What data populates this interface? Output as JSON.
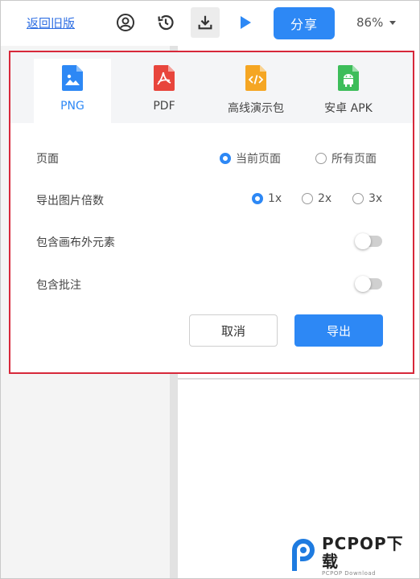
{
  "toolbar": {
    "back_label": "返回旧版",
    "share_label": "分享",
    "zoom_value": "86%",
    "icons": [
      "user-circle-icon",
      "history-icon",
      "download-icon",
      "play-icon"
    ]
  },
  "export_panel": {
    "formats": [
      {
        "label": "PNG",
        "icon": "png-file-icon",
        "color": "#2d88f5",
        "active": true
      },
      {
        "label": "PDF",
        "icon": "pdf-file-icon",
        "color": "#e8453c",
        "active": false
      },
      {
        "label": "高线演示包",
        "icon": "code-file-icon",
        "color": "#f5a623",
        "active": false
      },
      {
        "label": "安卓 APK",
        "icon": "android-file-icon",
        "color": "#3dbd5a",
        "active": false
      }
    ],
    "page_option": {
      "label": "页面",
      "options": [
        {
          "label": "当前页面",
          "checked": true
        },
        {
          "label": "所有页面",
          "checked": false
        }
      ]
    },
    "scale_option": {
      "label": "导出图片倍数",
      "options": [
        {
          "label": "1x",
          "checked": true
        },
        {
          "label": "2x",
          "checked": false
        },
        {
          "label": "3x",
          "checked": false
        }
      ]
    },
    "include_outside": {
      "label": "包含画布外元素",
      "enabled": false
    },
    "include_comments": {
      "label": "包含批注",
      "enabled": false
    },
    "cancel_label": "取消",
    "export_label": "导出"
  },
  "watermark": {
    "main": "PCPOP下载",
    "sub": "PCPOP Download"
  },
  "colors": {
    "accent": "#2d88f5",
    "highlight_border": "#d7283a"
  }
}
